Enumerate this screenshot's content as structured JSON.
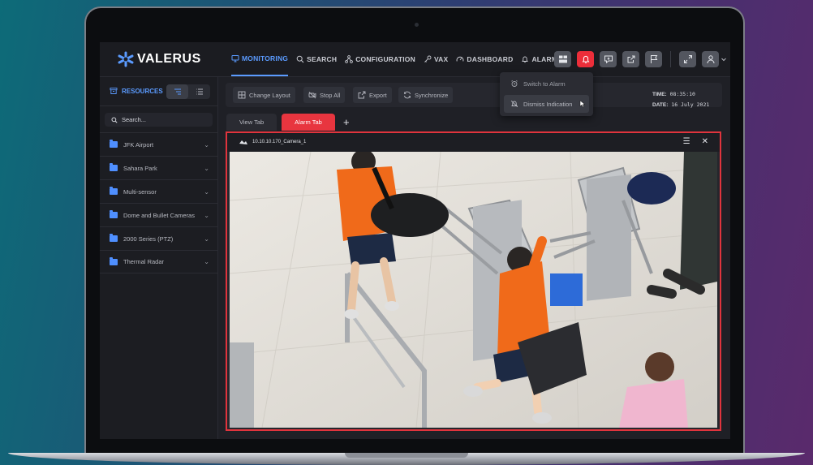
{
  "brand": {
    "name": "VALERUS"
  },
  "nav": {
    "items": [
      {
        "label": "MONITORING",
        "icon": "monitor-icon",
        "active": true
      },
      {
        "label": "SEARCH",
        "icon": "search-icon"
      },
      {
        "label": "CONFIGURATION",
        "icon": "hierarchy-icon"
      },
      {
        "label": "VAX",
        "icon": "key-icon"
      },
      {
        "label": "DASHBOARD",
        "icon": "gauge-icon"
      },
      {
        "label": "ALARMS",
        "icon": "bell-icon"
      }
    ]
  },
  "header_actions": [
    "layout-icon",
    "alarm-bell-icon",
    "message-icon",
    "share-icon",
    "flag-icon",
    "fullscreen-icon",
    "user-icon"
  ],
  "colors": {
    "accent": "#5b9bff",
    "alarm": "#e8353f",
    "background": "#1f2026"
  },
  "sidebar": {
    "title": "RESOURCES",
    "search_placeholder": "Search...",
    "items": [
      {
        "label": "JFK Airport"
      },
      {
        "label": "Sahara Park"
      },
      {
        "label": "Multi-sensor"
      },
      {
        "label": "Dome and Bullet Cameras"
      },
      {
        "label": "2000 Series (PTZ)"
      },
      {
        "label": "Thermal Radar"
      }
    ]
  },
  "toolbar": {
    "change_layout": "Change Layout",
    "stop_all": "Stop All",
    "export": "Export",
    "synchronize": "Synchronize"
  },
  "datetime": {
    "time_label": "TIME:",
    "time_value": "08:35:10",
    "date_label": "DATE:",
    "date_value": "16 July 2021"
  },
  "tabs": [
    {
      "label": "View Tab",
      "active": false
    },
    {
      "label": "Alarm Tab",
      "active": true
    }
  ],
  "video": {
    "camera_label": "10.10.10.170_Camera_1",
    "scene": "turnstile-surveillance-feed"
  },
  "alarm_menu": {
    "items": [
      {
        "label": "Switch to Alarm",
        "icon": "alarm-clock-icon"
      },
      {
        "label": "Dismiss Indication",
        "icon": "bell-off-icon"
      }
    ]
  }
}
